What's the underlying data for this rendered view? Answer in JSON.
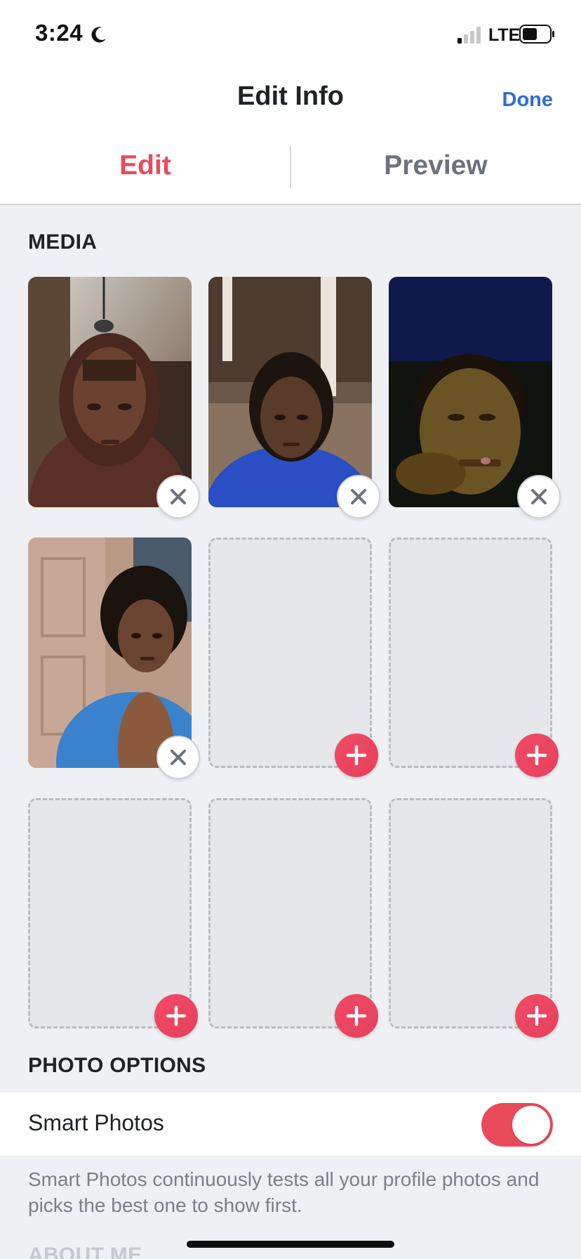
{
  "status_bar": {
    "time": "3:24",
    "network": "LTE",
    "icons": [
      "moon-icon",
      "signal-icon",
      "battery-icon"
    ]
  },
  "nav": {
    "title": "Edit Info",
    "done_label": "Done"
  },
  "tabs": [
    {
      "label": "Edit",
      "active": true
    },
    {
      "label": "Preview",
      "active": false
    }
  ],
  "media": {
    "heading": "MEDIA",
    "slots": [
      {
        "type": "photo",
        "action": "remove"
      },
      {
        "type": "photo",
        "action": "remove"
      },
      {
        "type": "photo",
        "action": "remove"
      },
      {
        "type": "photo",
        "action": "remove"
      },
      {
        "type": "empty",
        "action": "add"
      },
      {
        "type": "empty",
        "action": "add"
      },
      {
        "type": "empty",
        "action": "add"
      },
      {
        "type": "empty",
        "action": "add"
      },
      {
        "type": "empty",
        "action": "add"
      }
    ]
  },
  "photo_options": {
    "heading": "PHOTO OPTIONS",
    "smart_photos_label": "Smart Photos",
    "smart_photos_enabled": true,
    "smart_photos_description": "Smart Photos continuously tests all your profile photos and picks the best one to show first."
  },
  "next_section_heading": "ABOUT ME",
  "colors": {
    "accent": "#ea4a5a",
    "link": "#2e6ed6",
    "background": "#eff0f3"
  }
}
